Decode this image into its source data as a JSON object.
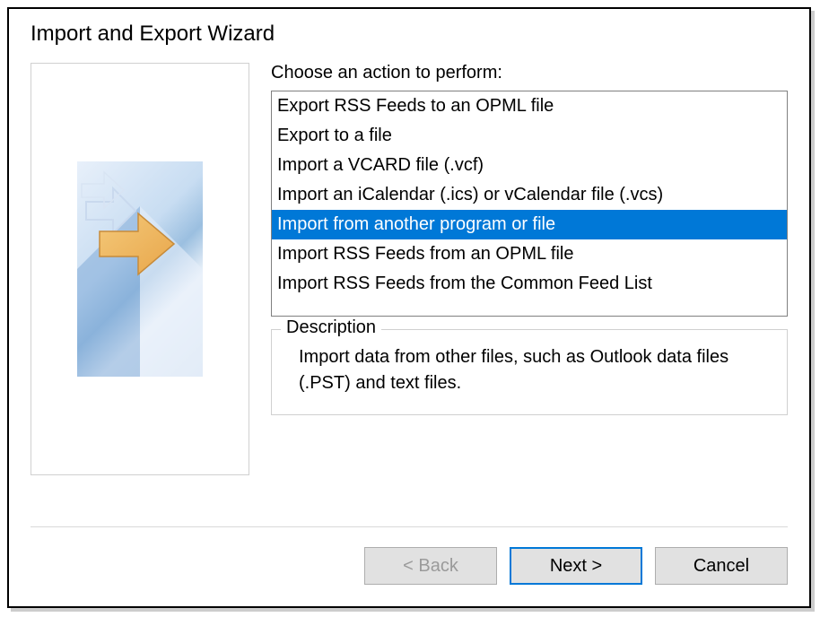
{
  "title": "Import and Export Wizard",
  "prompt": "Choose an action to perform:",
  "actions": [
    {
      "label": "Export RSS Feeds to an OPML file",
      "selected": false
    },
    {
      "label": "Export to a file",
      "selected": false
    },
    {
      "label": "Import a VCARD file (.vcf)",
      "selected": false
    },
    {
      "label": "Import an iCalendar (.ics) or vCalendar file (.vcs)",
      "selected": false
    },
    {
      "label": "Import from another program or file",
      "selected": true
    },
    {
      "label": "Import RSS Feeds from an OPML file",
      "selected": false
    },
    {
      "label": "Import RSS Feeds from the Common Feed List",
      "selected": false
    }
  ],
  "description": {
    "legend": "Description",
    "text": "Import data from other files, such as Outlook data files (.PST) and text files."
  },
  "buttons": {
    "back": "< Back",
    "next": "Next >",
    "cancel": "Cancel"
  }
}
